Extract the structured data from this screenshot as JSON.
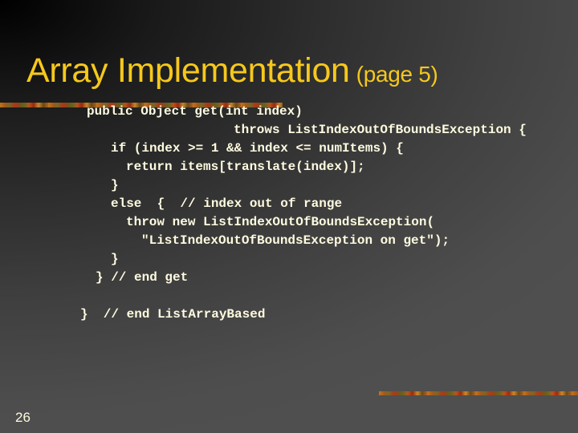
{
  "slide": {
    "title": "Array Implementation",
    "title_suffix": "(page 5)",
    "page_number": "26",
    "colors": {
      "title": "#f6c81c",
      "code_text": "#fffbe0",
      "background_dark": "#000000",
      "background_light": "#4d4d4d"
    },
    "code_lines": [
      "public Object get(int index)",
      "throws ListIndexOutOfBoundsException {",
      "if (index >= 1 && index <= numItems) {",
      "return items[translate(index)];",
      "}",
      "else  {  // index out of range",
      "throw new ListIndexOutOfBoundsException(",
      "\"ListIndexOutOfBoundsException on get\");",
      "}",
      "} // end get",
      "}  // end ListArrayBased"
    ]
  }
}
